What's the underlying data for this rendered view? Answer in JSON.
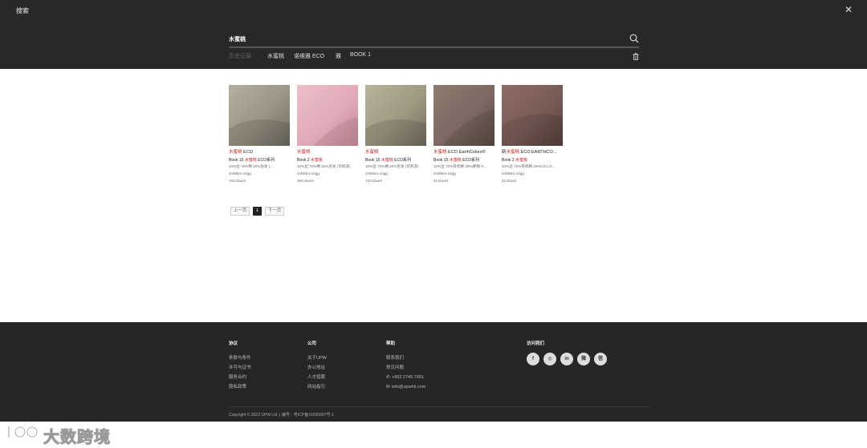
{
  "header": {
    "title": "搜索",
    "close_glyph": "✕",
    "search_value": "水蜜桃",
    "history_label": "历史记录:",
    "history": [
      "水蜜桃",
      "诺维雅 ECO",
      "雅",
      "BOOK 1"
    ]
  },
  "products": [
    {
      "name_hl": "水蜜桃",
      "name_rest": " ECO",
      "book_pre": "Book 15 ",
      "book_hl": "水蜜桃",
      "book_rest": " ECO系列",
      "composition": "10%丝 70%棉 20%尼龙 (...",
      "count": "2/48Nm-14gg",
      "colors": "72Colours",
      "swatch": "#9d9787"
    },
    {
      "name_hl": "水蜜桃",
      "name_rest": "",
      "book_pre": "Book 2 ",
      "book_hl": "水蜜桃",
      "book_rest": "",
      "composition": "10%丝 70%棉 20%尼龙 (可机洗)",
      "count": "2/48Nm-14gg",
      "colors": "48Colours",
      "swatch": "#e2b0bb"
    },
    {
      "name_hl": "水蜜桃",
      "name_rest": "",
      "book_pre": "Book 15 ",
      "book_hl": "水蜜桃",
      "book_rest": " ECO系列",
      "composition": "10%丝 70%棉 20%尼龙 (可机洗)",
      "count": "2/48Nm-14gg",
      "colors": "72Colours",
      "swatch": "#a29c85"
    },
    {
      "name_hl": "水蜜桃",
      "name_rest": " ECO EarthColors®",
      "book_pre": "Book 15 ",
      "book_hl": "水蜜桃",
      "book_rest": " ECO系列",
      "composition": "10%丝 70%有机棉 20%奢锦 ®...",
      "count": "2/48Nm-14gg",
      "colors": "4Colours",
      "swatch": "#7e6a62"
    },
    {
      "name_hl": "水蜜桃",
      "name_pre": "新",
      "name_rest": " ECO EARTHCO...",
      "book_pre": "Book 2 ",
      "book_hl": "水蜜桃",
      "book_rest": "",
      "composition": "10%丝 70%有机棉 20%CICLO...",
      "count": "2/48Nm-14gg",
      "colors": "4Colours",
      "swatch": "#7b5e58"
    }
  ],
  "pager": {
    "prev": "上一页",
    "current": "1",
    "next": "下一页"
  },
  "footer": {
    "col1": {
      "head": "协议",
      "links": [
        "条款与条件",
        "许可与证书",
        "服务合约",
        "隐私政策"
      ]
    },
    "col2": {
      "head": "公司",
      "links": [
        "关于UPW",
        "办公地址",
        "人才招聘",
        "网站指引"
      ]
    },
    "col3": {
      "head": "帮助",
      "links": [
        "联系我们",
        "常见问题"
      ],
      "phone": "+852 2745 7991",
      "email": "info@upwhk.com"
    },
    "social_head": "访问我们",
    "social": [
      "f",
      "◎",
      "in",
      "微",
      "信"
    ],
    "copyright": "Copyright © 2022 UPW Ltd. | 编号：粤ICP备16035697号-1"
  },
  "watermark": {
    "text": "大数跨境"
  }
}
